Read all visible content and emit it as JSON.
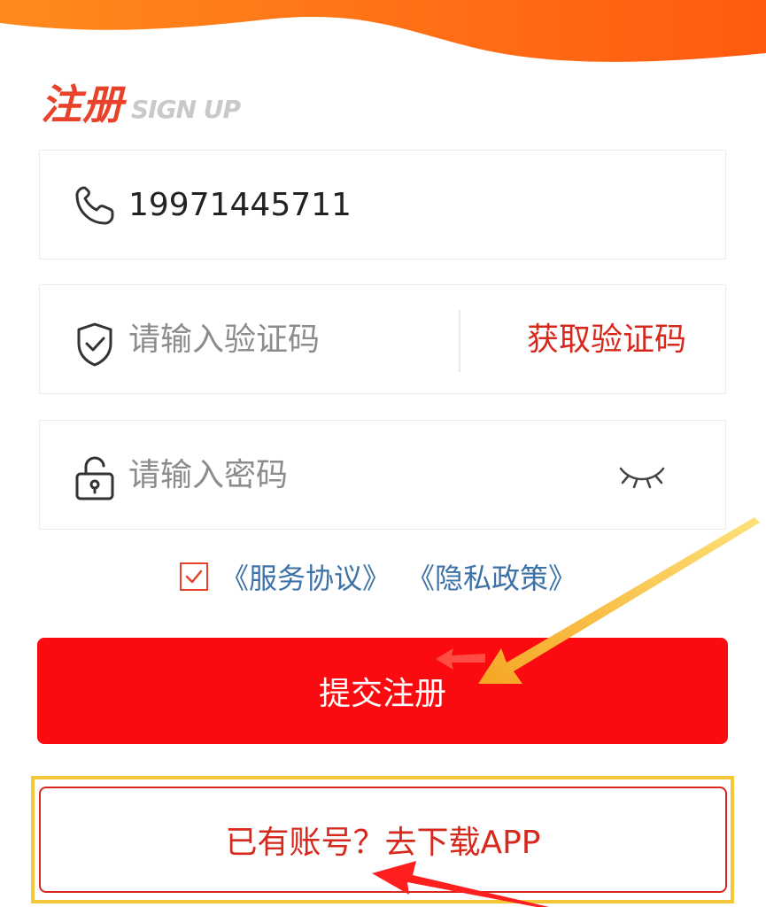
{
  "header": {
    "title_cn": "注册",
    "title_en": "SIGN UP"
  },
  "form": {
    "phone": {
      "value": "19971445711",
      "icon": "phone-icon"
    },
    "code": {
      "placeholder": "请输入验证码",
      "icon": "shield-check-icon",
      "send_label": "获取验证码"
    },
    "password": {
      "placeholder": "请输入密码",
      "icon": "lock-icon",
      "toggle_icon": "eye-closed-icon"
    },
    "agreement": {
      "checked": true,
      "terms_label": "《服务协议》",
      "privacy_label": "《隐私政策》"
    },
    "submit_label": "提交注册",
    "download_label": "已有账号？去下载APP"
  },
  "colors": {
    "accent_red": "#fb0a0f",
    "title_red": "#e8432a",
    "link_blue": "#3c72a8",
    "wave_orange": "#ff7a12",
    "annotation_yellow": "#f5c53a"
  }
}
